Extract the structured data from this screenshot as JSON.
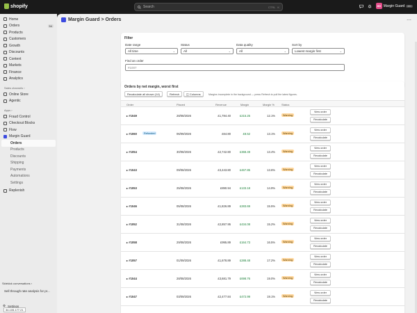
{
  "topbar": {
    "brand": "shopify",
    "search_placeholder": "Search",
    "search_shortcut_1": "CTRL",
    "search_shortcut_2": "K",
    "store_initials": "MG",
    "store_name": "Margin Guard",
    "store_badge": "dev"
  },
  "sidebar": {
    "main": [
      {
        "label": "Home",
        "icon": "home-icon"
      },
      {
        "label": "Orders",
        "icon": "orders-icon",
        "count": "54"
      },
      {
        "label": "Products",
        "icon": "products-icon"
      },
      {
        "label": "Customers",
        "icon": "customers-icon"
      },
      {
        "label": "Growth",
        "icon": "growth-icon"
      },
      {
        "label": "Discounts",
        "icon": "discounts-icon"
      },
      {
        "label": "Content",
        "icon": "content-icon"
      },
      {
        "label": "Markets",
        "icon": "markets-icon"
      },
      {
        "label": "Finance",
        "icon": "finance-icon"
      },
      {
        "label": "Analytics",
        "icon": "analytics-icon"
      }
    ],
    "sales_channels_label": "Sales channels",
    "channels": [
      {
        "label": "Online Store",
        "icon": "store-icon"
      },
      {
        "label": "Agentic",
        "icon": "agentic-icon"
      }
    ],
    "apps_label": "Apps",
    "apps": [
      {
        "label": "Fraud Control",
        "icon": "fraud-icon"
      },
      {
        "label": "Checkout Blocks",
        "icon": "checkout-icon"
      },
      {
        "label": "Flow",
        "icon": "flow-icon"
      },
      {
        "label": "Margin Guard",
        "icon": "margin-guard-icon"
      }
    ],
    "sub_items": [
      "Orders",
      "Products",
      "Discounts",
      "Shipping",
      "Payments",
      "Automations",
      "Settings"
    ],
    "extra": {
      "label": "Replenish",
      "icon": "replenish-icon"
    },
    "sidekick_label": "Sidekick conversations",
    "sidekick_item": "Sell through rate analysis for pr...",
    "settings_label": "Settings",
    "ip": "34.105.177.21"
  },
  "page": {
    "title": "Margin Guard > Orders"
  },
  "filter": {
    "title": "Filter",
    "date_range_label": "Date range",
    "date_range_value": "All time",
    "status_label": "Status",
    "status_value": "All",
    "quality_label": "Data quality",
    "quality_value": "All",
    "sort_label": "Sort by",
    "sort_value": "Lowest margin first",
    "find_label": "Find an order",
    "find_placeholder": "#1007"
  },
  "orders": {
    "title": "Orders by net margin, worst first",
    "recalc_label": "Recalculate all shown (14)",
    "refresh_label": "Refresh",
    "columns_label": "Columns",
    "note": "Margins incomplete in the background — press Refresh to pull the latest figures.",
    "headers": {
      "order": "Order",
      "placed": "Placed",
      "revenue": "Revenue",
      "margin": "Margin",
      "margin_pct": "Margin %",
      "status": "Status"
    },
    "view_label": "View order",
    "recalc_row_label": "Recalculate",
    "rows": [
      {
        "order": "#1049",
        "placed": "28/08/2026",
        "revenue": "£1,784.40",
        "margin": "£215.25",
        "pct": "12.1%",
        "status": "Warning"
      },
      {
        "order": "#1060",
        "tag": "Refunded",
        "placed": "06/09/2026",
        "revenue": "£64.80",
        "margin": "£8.52",
        "pct": "13.1%",
        "status": "Warning"
      },
      {
        "order": "#1054",
        "placed": "30/08/2026",
        "revenue": "£2,742.80",
        "margin": "£368.49",
        "pct": "13.4%",
        "status": "Warning"
      },
      {
        "order": "#1043",
        "placed": "09/08/2026",
        "revenue": "£3,443.80",
        "margin": "£467.85",
        "pct": "13.6%",
        "status": "Warning"
      },
      {
        "order": "#1053",
        "placed": "25/08/2026",
        "revenue": "£890.94",
        "margin": "£133.18",
        "pct": "14.9%",
        "status": "Warning"
      },
      {
        "order": "#1046",
        "placed": "05/08/2026",
        "revenue": "£1,826.89",
        "margin": "£283.69",
        "pct": "15.5%",
        "status": "Warning"
      },
      {
        "order": "#1052",
        "placed": "31/08/2026",
        "revenue": "£2,857.95",
        "margin": "£434.08",
        "pct": "15.2%",
        "status": "Warning"
      },
      {
        "order": "#1058",
        "placed": "29/08/2026",
        "revenue": "£995.89",
        "margin": "£164.73",
        "pct": "16.5%",
        "status": "Warning"
      },
      {
        "order": "#1057",
        "placed": "01/09/2026",
        "revenue": "£1,678.89",
        "margin": "£288.48",
        "pct": "17.2%",
        "status": "Warning"
      },
      {
        "order": "#1044",
        "placed": "28/08/2026",
        "revenue": "£3,681.79",
        "margin": "£698.76",
        "pct": "19.0%",
        "status": "Warning"
      },
      {
        "order": "#1047",
        "placed": "03/09/2026",
        "revenue": "£2,477.84",
        "margin": "£472.99",
        "pct": "19.1%",
        "status": "Warning"
      }
    ]
  }
}
